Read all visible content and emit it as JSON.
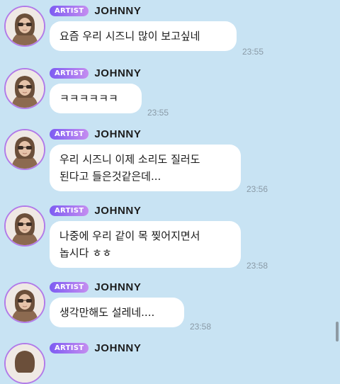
{
  "messages": [
    {
      "badge": "ARTIST",
      "name": "JOHNNY",
      "lines": [
        "요즘 우리 시즈니 많이 보고싶네"
      ],
      "time": "23:55"
    },
    {
      "badge": "ARTIST",
      "name": "JOHNNY",
      "lines": [
        "ㅋㅋㅋㅋㅋㅋ"
      ],
      "time": "23:55"
    },
    {
      "badge": "ARTIST",
      "name": "JOHNNY",
      "lines": [
        "우리 시즈니 이제 소리도 질러도",
        "된다고 들은것같은데..."
      ],
      "time": "23:56"
    },
    {
      "badge": "ARTIST",
      "name": "JOHNNY",
      "lines": [
        "나중에 우리 같이 목 찢어지면서",
        "놉시다 ㅎㅎ"
      ],
      "time": "23:58"
    },
    {
      "badge": "ARTIST",
      "name": "JOHNNY",
      "lines": [
        "생각만해도 설레네...."
      ],
      "time": "23:58"
    },
    {
      "badge": "ARTIST",
      "name": "JOHNNY",
      "lines": [],
      "time": ""
    }
  ],
  "colors": {
    "background": "#c8e3f3",
    "bubble": "#ffffff",
    "badge_gradient_start": "#7d5cf2",
    "badge_gradient_end": "#c58df0",
    "avatar_ring": "#b27be8",
    "timestamp": "#8a9aa6"
  },
  "icons": {
    "avatar": "profile-photo-avatar"
  }
}
